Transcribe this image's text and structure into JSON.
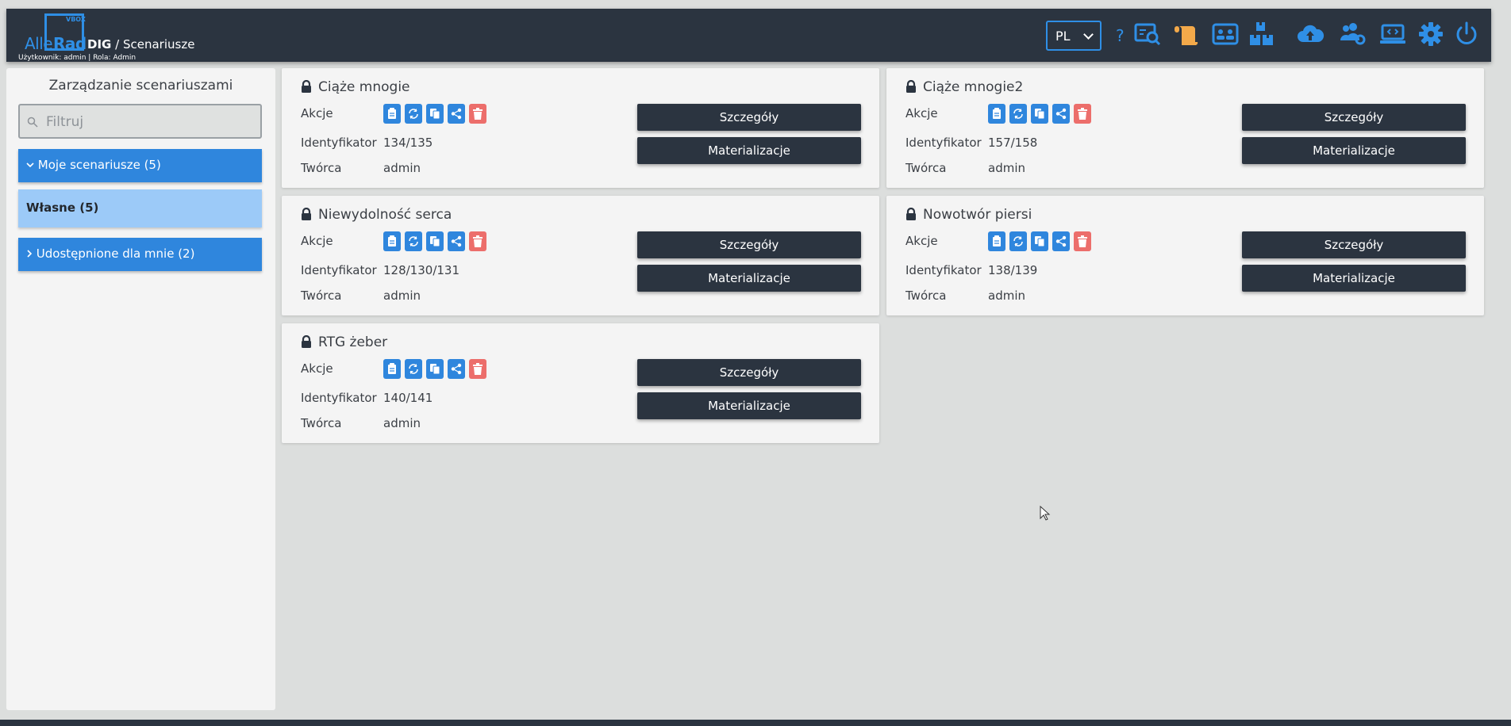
{
  "header": {
    "logo": {
      "alle": "Alle",
      "rad": "Rad",
      "vbox": "VBOX"
    },
    "app": "DIG",
    "separator": "/",
    "section": "Scenariusze",
    "userline": "Użytkownik: admin | Rola: Admin",
    "language": "PL",
    "help": "?",
    "icons": [
      "study-search-icon",
      "scroll-icon",
      "patients-card-icon",
      "packages-icon",
      "cloud-upload-icon",
      "users-settings-icon",
      "laptop-code-icon",
      "settings-gear-icon",
      "power-icon"
    ],
    "icon_colors": {
      "blue": "#2f8fe6",
      "orange": "#f3a94a"
    }
  },
  "sidebar": {
    "title": "Zarządzanie scenariuszami",
    "filter_placeholder": "Filtruj",
    "my_group": "Moje scenariusze (5)",
    "own": "Własne (5)",
    "shared": "Udostępnione dla mnie (2)"
  },
  "labels": {
    "actions": "Akcje",
    "identifier": "Identyfikator",
    "creator": "Twórca",
    "details_btn": "Szczegóły",
    "materializations_btn": "Materializacje"
  },
  "action_icons": [
    "clipboard-icon",
    "refresh-icon",
    "copy-icon",
    "share-icon",
    "trash-icon"
  ],
  "cards": [
    {
      "title": "Ciąże mnogie",
      "identifier": "134/135",
      "creator": "admin"
    },
    {
      "title": "Ciąże mnogie2",
      "identifier": "157/158",
      "creator": "admin"
    },
    {
      "title": "Niewydolność serca",
      "identifier": "128/130/131",
      "creator": "admin"
    },
    {
      "title": "Nowotwór piersi",
      "identifier": "138/139",
      "creator": "admin"
    },
    {
      "title": "RTG żeber",
      "identifier": "140/141",
      "creator": "admin"
    }
  ]
}
